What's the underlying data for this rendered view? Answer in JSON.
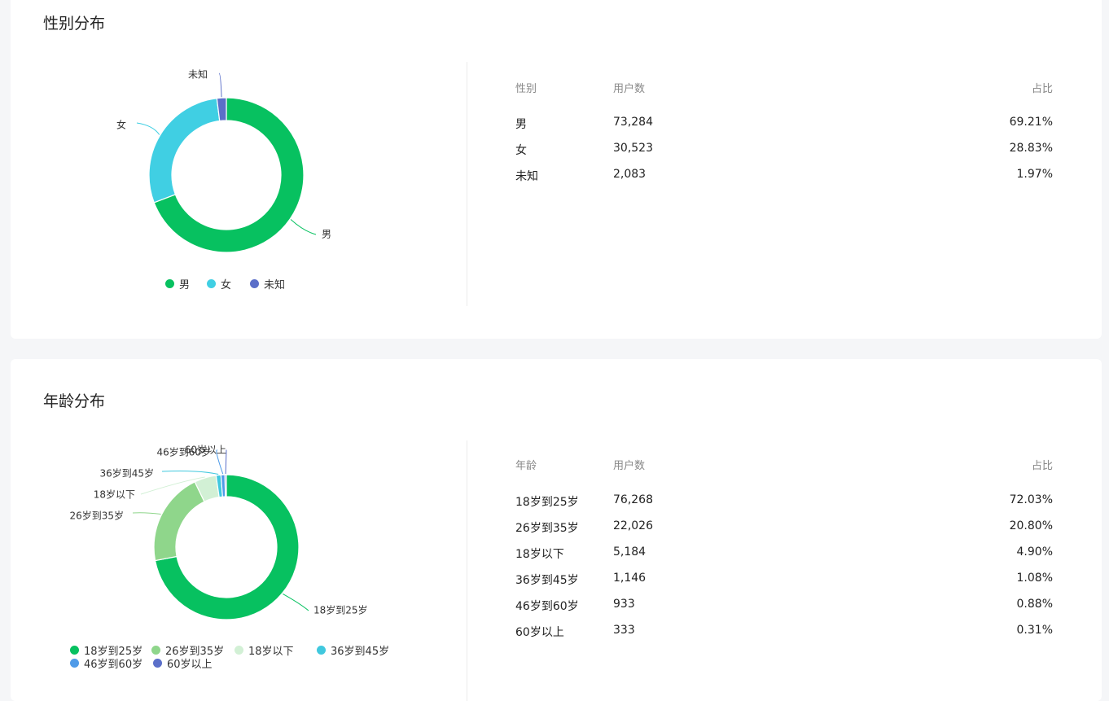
{
  "gender": {
    "title": "性别分布",
    "table": {
      "headers": [
        "性别",
        "用户数",
        "占比"
      ],
      "rows": [
        [
          "男",
          "73,284",
          "69.21%"
        ],
        [
          "女",
          "30,523",
          "28.83%"
        ],
        [
          "未知",
          "2,083",
          "1.97%"
        ]
      ]
    }
  },
  "age": {
    "title": "年龄分布",
    "table": {
      "headers": [
        "年龄",
        "用户数",
        "占比"
      ],
      "rows": [
        [
          "18岁到25岁",
          "76,268",
          "72.03%"
        ],
        [
          "26岁到35岁",
          "22,026",
          "20.80%"
        ],
        [
          "18岁以下",
          "5,184",
          "4.90%"
        ],
        [
          "36岁到45岁",
          "1,146",
          "1.08%"
        ],
        [
          "46岁到60岁",
          "933",
          "0.88%"
        ],
        [
          "60岁以上",
          "333",
          "0.31%"
        ]
      ]
    }
  },
  "chart_data": [
    {
      "type": "pie",
      "variant": "donut",
      "categories": [
        "男",
        "女",
        "未知"
      ],
      "values": [
        73284,
        30523,
        2083
      ],
      "colors": [
        "#07c160",
        "#40cfe3",
        "#5b6fc9"
      ],
      "legend": "bottom"
    },
    {
      "type": "pie",
      "variant": "donut",
      "categories": [
        "18岁到25岁",
        "26岁到35岁",
        "18岁以下",
        "36岁到45岁",
        "46岁到60岁",
        "60岁以上"
      ],
      "values": [
        76268,
        22026,
        5184,
        1146,
        933,
        333
      ],
      "colors": [
        "#07c160",
        "#8fd68b",
        "#d2f0d5",
        "#40c8de",
        "#4f9be8",
        "#5b6fc9"
      ],
      "legend": "bottom"
    }
  ]
}
